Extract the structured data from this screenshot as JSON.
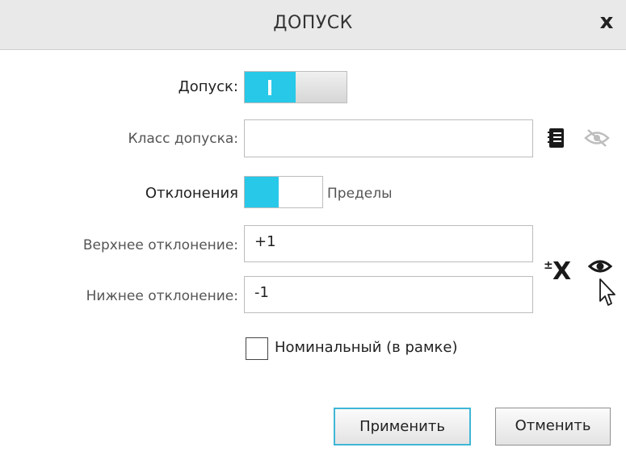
{
  "dialog": {
    "title": "ДОПУСК",
    "close_label": "x"
  },
  "tolerance": {
    "label": "Допуск:",
    "enabled": true
  },
  "tolerance_class": {
    "label": "Класс допуска:",
    "value": ""
  },
  "mode": {
    "left_label": "Отклонения",
    "right_label": "Пределы",
    "selected": "Отклонения"
  },
  "upper": {
    "label": "Верхнее отклонение:",
    "value": "+1"
  },
  "lower": {
    "label": "Нижнее отклонение:",
    "value": "-1"
  },
  "nominal": {
    "label": "Номинальный (в рамке)",
    "checked": false
  },
  "buttons": {
    "apply": "Применить",
    "cancel": "Отменить"
  },
  "icons": [
    "book-icon",
    "eye-hidden-icon",
    "plus-minus-x-icon",
    "eye-icon",
    "mouse-cursor-icon"
  ]
}
